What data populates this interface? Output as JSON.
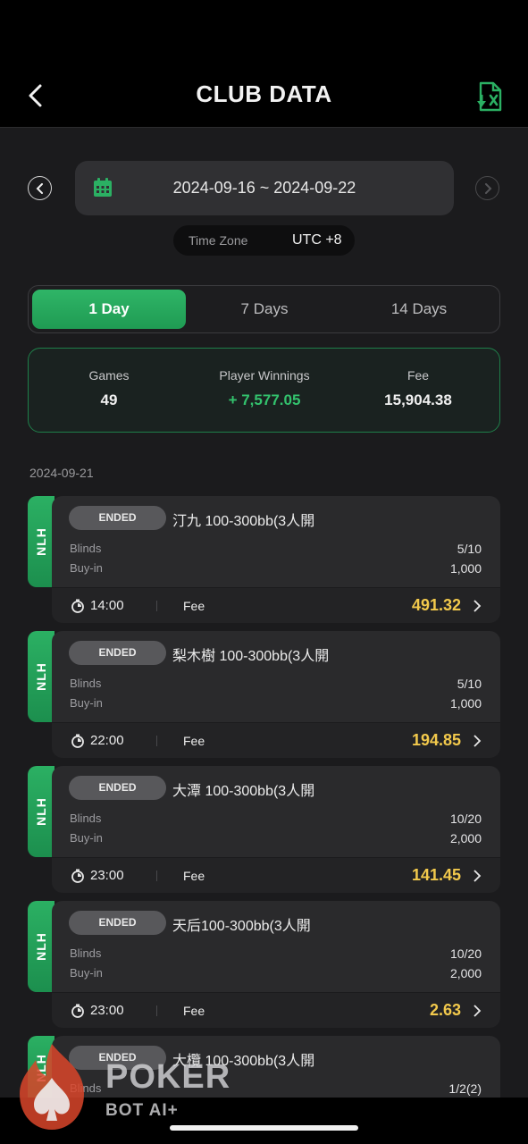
{
  "header": {
    "title": "CLUB DATA",
    "back_icon": "chevron-left-icon",
    "export_icon": "excel-download-icon"
  },
  "date_range": {
    "text": "2024-09-16 ~ 2024-09-22",
    "calendar_icon": "calendar-icon",
    "prev_icon": "chevron-left-circle-icon",
    "next_icon": "chevron-right-circle-icon"
  },
  "timezone": {
    "label": "Time Zone",
    "value": "UTC +8"
  },
  "tabs": [
    {
      "label": "1 Day",
      "active": true
    },
    {
      "label": "7 Days",
      "active": false
    },
    {
      "label": "14 Days",
      "active": false
    }
  ],
  "summary": {
    "games_label": "Games",
    "games_value": "49",
    "winnings_label": "Player Winnings",
    "winnings_value": "+ 7,577.05",
    "fee_label": "Fee",
    "fee_value": "15,904.38"
  },
  "section_date": "2024-09-21",
  "games": [
    {
      "tag": "NLH",
      "status": "ENDED",
      "name": "汀九 100-300bb(3人開",
      "blinds_label": "Blinds",
      "blinds": "5/10",
      "buyin_label": "Buy-in",
      "buyin": "1,000",
      "time": "14:00",
      "fee_label": "Fee",
      "fee": "491.32"
    },
    {
      "tag": "NLH",
      "status": "ENDED",
      "name": "梨木樹 100-300bb(3人開",
      "blinds_label": "Blinds",
      "blinds": "5/10",
      "buyin_label": "Buy-in",
      "buyin": "1,000",
      "time": "22:00",
      "fee_label": "Fee",
      "fee": "194.85"
    },
    {
      "tag": "NLH",
      "status": "ENDED",
      "name": "大潭 100-300bb(3人開",
      "blinds_label": "Blinds",
      "blinds": "10/20",
      "buyin_label": "Buy-in",
      "buyin": "2,000",
      "time": "23:00",
      "fee_label": "Fee",
      "fee": "141.45"
    },
    {
      "tag": "NLH",
      "status": "ENDED",
      "name": "天后100-300bb(3人開",
      "blinds_label": "Blinds",
      "blinds": "10/20",
      "buyin_label": "Buy-in",
      "buyin": "2,000",
      "time": "23:00",
      "fee_label": "Fee",
      "fee": "2.63"
    },
    {
      "tag": "NLH",
      "status": "ENDED",
      "name": "大欖 100-300bb(3人開",
      "blinds_label": "Blinds",
      "blinds": "1/2(2)"
    }
  ],
  "watermark": {
    "line1": "POKER",
    "line2": "BOT AI+"
  },
  "colors": {
    "accent_green": "#2bb063",
    "fee_yellow": "#f2c94c",
    "winnings_green": "#33c26d"
  }
}
